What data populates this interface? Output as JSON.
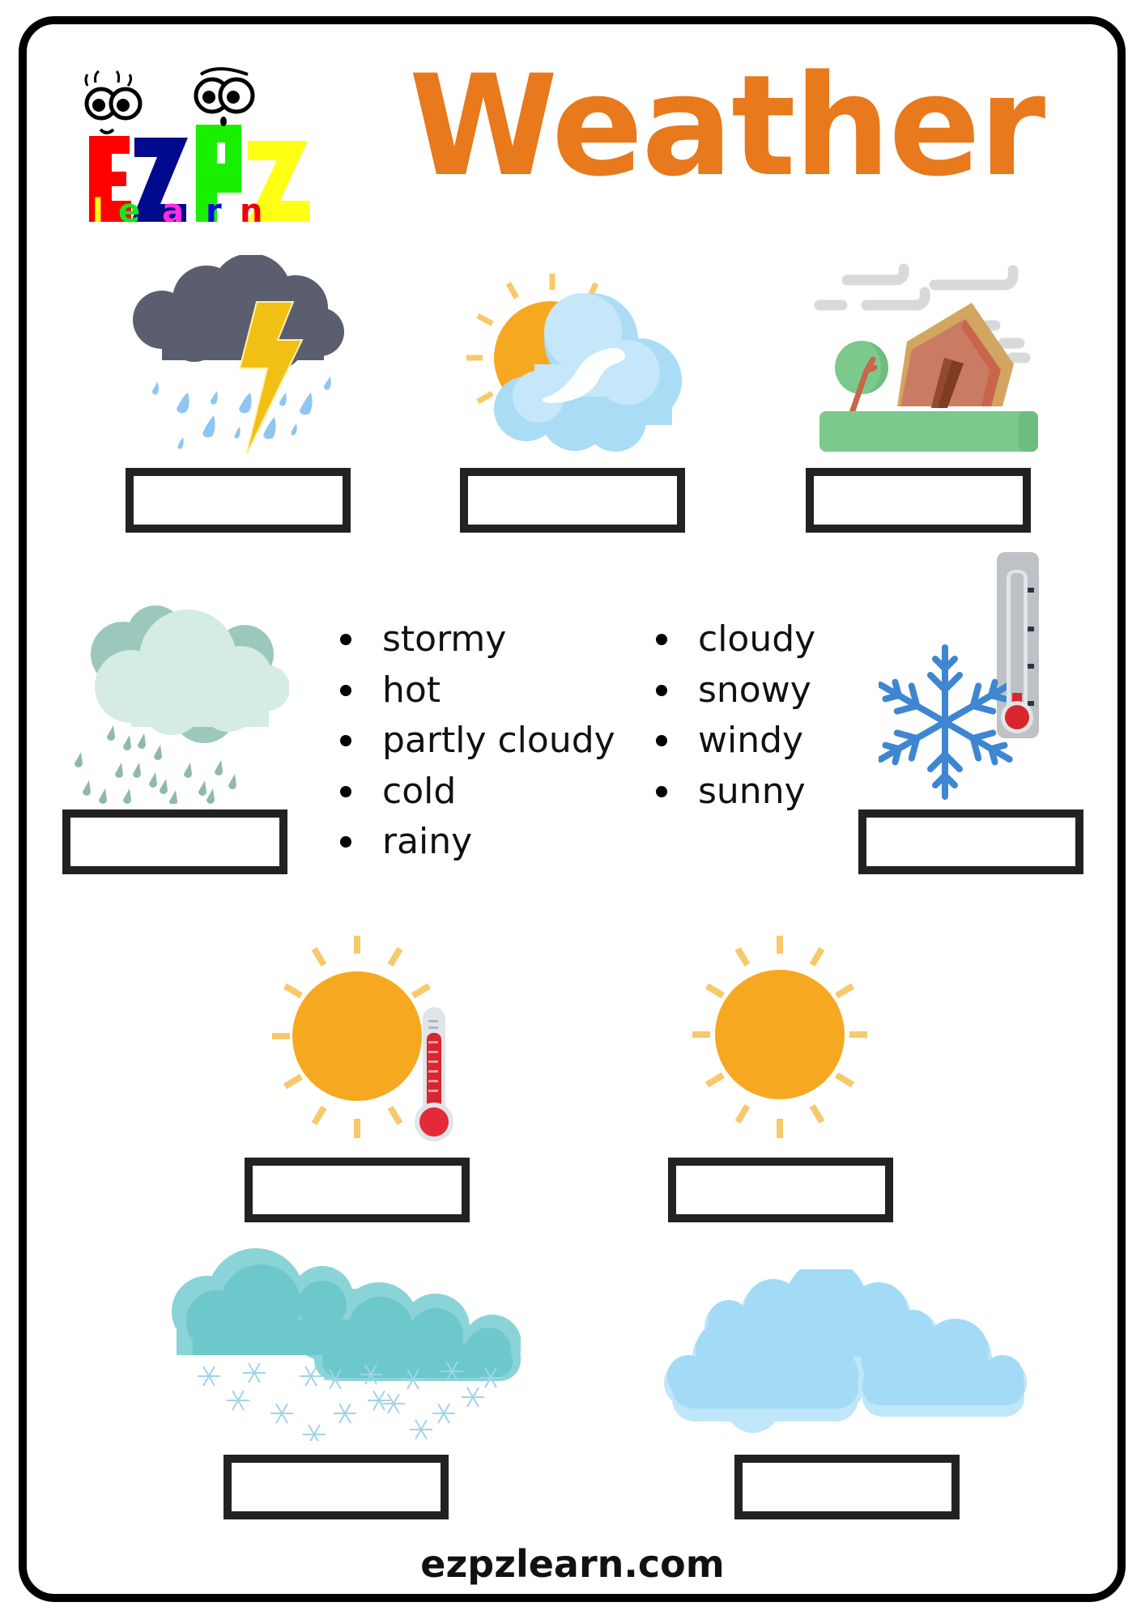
{
  "logo": {
    "top_letters": [
      "E",
      "Z",
      "P",
      "Z"
    ],
    "top_colors": [
      "#FF0000",
      "#000A8C",
      "#19F000",
      "#FFFF14"
    ],
    "bottom_word": "learn",
    "bottom_colors": [
      "#FFFF14",
      "#19E61E",
      "#FF2BE0",
      "#0A0AE6",
      "#F00000"
    ]
  },
  "title": {
    "text": "Weather",
    "color": "#E8791C"
  },
  "pictures": [
    {
      "id": "stormy",
      "icon": "storm-cloud-lightning-rain-icon"
    },
    {
      "id": "partly-cloudy",
      "icon": "sun-behind-cloud-icon"
    },
    {
      "id": "windy",
      "icon": "wind-tilted-house-icon"
    },
    {
      "id": "rainy",
      "icon": "rain-cloud-icon"
    },
    {
      "id": "cold",
      "icon": "snowflake-thermometer-icon"
    },
    {
      "id": "hot",
      "icon": "sun-thermometer-icon"
    },
    {
      "id": "sunny",
      "icon": "sun-icon"
    },
    {
      "id": "snowy",
      "icon": "snow-clouds-icon"
    },
    {
      "id": "cloudy",
      "icon": "clouds-icon"
    }
  ],
  "answer_boxes": [
    "",
    "",
    "",
    "",
    "",
    "",
    "",
    "",
    ""
  ],
  "word_bank": {
    "column_1": [
      "stormy",
      "hot",
      "partly cloudy",
      "cold",
      "rainy"
    ],
    "column_2": [
      "cloudy",
      "snowy",
      "windy",
      "sunny"
    ]
  },
  "footer": {
    "text": "ezpzlearn.com"
  }
}
